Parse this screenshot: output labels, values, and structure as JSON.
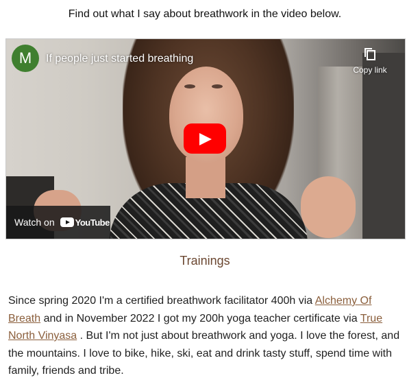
{
  "intro_text": "Find out what I say about breathwork in the video below.",
  "video": {
    "channel_initial": "M",
    "title": "If people just started breathing",
    "copy_link_label": "Copy link",
    "watch_on_label": "Watch on",
    "youtube_label": "YouTube",
    "accent_color": "#ff0000"
  },
  "section_heading": "Trainings",
  "paragraph": {
    "part1": "Since spring 2020 I'm a certified breathwork facilitator 400h via ",
    "link1": "Alchemy Of Breath",
    "part2": " and in November 2022 I got my 200h yoga teacher certificate via ",
    "link2": "True North Vinyasa",
    "part3": " . But I'm not just about breathwork and yoga. I love the forest, and the mountains. I love to bike, hike, ski, eat and drink tasty stuff, spend time with family, friends and tribe."
  },
  "colors": {
    "heading": "#6b4731",
    "link": "#8a5e3b",
    "avatar": "#3f7f2f"
  }
}
